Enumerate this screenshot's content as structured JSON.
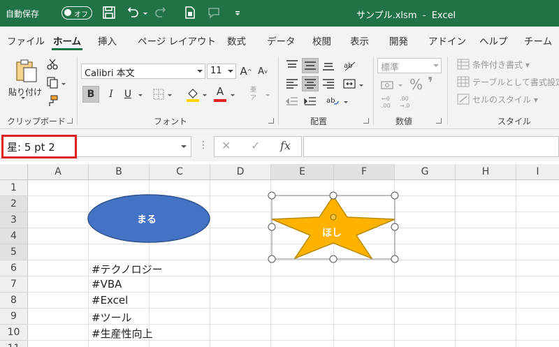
{
  "titlebar": {
    "autosave_label": "自動保存",
    "autosave_state": "オフ",
    "filename": "サンプル.xlsm",
    "separator": "-",
    "app": "Excel"
  },
  "tabs": [
    {
      "label": "ファイル"
    },
    {
      "label": "ホーム"
    },
    {
      "label": "挿入"
    },
    {
      "label": "ページ レイアウト"
    },
    {
      "label": "数式"
    },
    {
      "label": "データ"
    },
    {
      "label": "校閲"
    },
    {
      "label": "表示"
    },
    {
      "label": "開発"
    },
    {
      "label": "アドイン"
    },
    {
      "label": "ヘルプ"
    },
    {
      "label": "チーム"
    }
  ],
  "ribbon": {
    "clipboard": {
      "label": "クリップボード",
      "paste": "貼り付け"
    },
    "font": {
      "label": "フォント",
      "font_name": "Calibri 本文",
      "font_size": "11",
      "bold": "B",
      "italic": "I",
      "underline": "U",
      "grow": "A",
      "shrink": "A",
      "font_color_letter": "A",
      "phonetic_top": "亜",
      "phonetic_bottom": "ア"
    },
    "alignment": {
      "label": "配置"
    },
    "number": {
      "label": "数値",
      "format": "標準",
      "percent": "%",
      "comma": "❜",
      "inc_decimal_top": "←0",
      "inc_decimal_bottom": ".00",
      "dec_decimal_top": ".00",
      "dec_decimal_bottom": "→.0"
    },
    "styles": {
      "label": "スタイル",
      "conditional": "条件付き書式",
      "table": "テーブルとして書式設定",
      "cell_styles": "セルのスタイル"
    },
    "colors": {
      "accent_green": "#217346",
      "font_color_red": "#e32020",
      "fill_yellow": "#ffd400"
    }
  },
  "formula_bar": {
    "name_box": "星: 5 pt 2",
    "cancel": "✕",
    "enter": "✓",
    "fx": "fx",
    "formula": ""
  },
  "grid": {
    "columns": [
      "A",
      "B",
      "C",
      "D",
      "E",
      "F",
      "G",
      "H",
      "I"
    ],
    "rows": [
      "1",
      "2",
      "3",
      "4",
      "5",
      "6",
      "7",
      "8",
      "9",
      "10",
      "11"
    ],
    "cells": [
      {
        "ref": "B6",
        "text": "#テクノロジー"
      },
      {
        "ref": "B7",
        "text": "#VBA"
      },
      {
        "ref": "B8",
        "text": "#Excel"
      },
      {
        "ref": "B9",
        "text": "#ツール"
      },
      {
        "ref": "B10",
        "text": "#生産性向上"
      }
    ]
  },
  "shapes": {
    "oval": {
      "text": "まる",
      "fill": "#4472c4",
      "stroke": "#2f528f"
    },
    "star": {
      "text": "ほし",
      "fill": "#ffb300",
      "stroke": "#b98a00"
    }
  }
}
